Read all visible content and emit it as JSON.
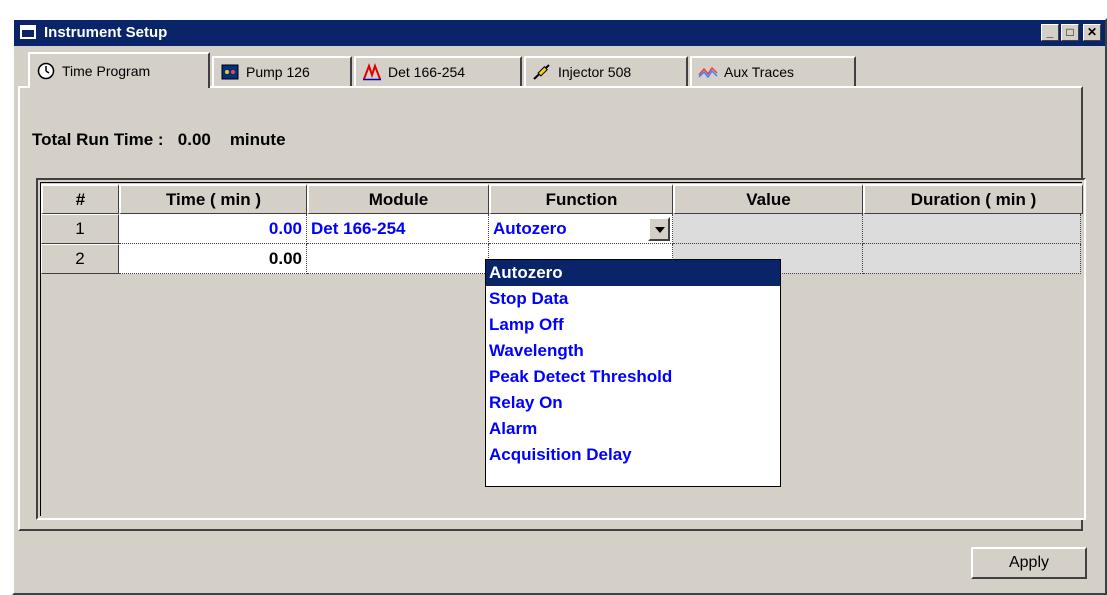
{
  "window": {
    "title": "Instrument Setup"
  },
  "tabs": [
    {
      "label": "Time Program",
      "icon": "clock-icon"
    },
    {
      "label": "Pump 126",
      "icon": "pump-icon"
    },
    {
      "label": "Det 166-254",
      "icon": "detector-peak-icon"
    },
    {
      "label": "Injector 508",
      "icon": "syringe-icon"
    },
    {
      "label": "Aux Traces",
      "icon": "traces-icon"
    }
  ],
  "total_run_time": {
    "label": "Total Run Time :",
    "value": "0.00",
    "unit": "minute"
  },
  "table": {
    "headers": [
      "#",
      "Time ( min )",
      "Module",
      "Function",
      "Value",
      "Duration ( min )"
    ],
    "rows": [
      {
        "num": "1",
        "time": "0.00",
        "module": "Det 166-254",
        "function": "Autozero",
        "value": "",
        "duration": ""
      },
      {
        "num": "2",
        "time": "0.00",
        "module": "",
        "function": "",
        "value": "",
        "duration": ""
      }
    ]
  },
  "dropdown": {
    "options": [
      "Autozero",
      "Stop Data",
      "Lamp Off",
      "Wavelength",
      "Peak Detect Threshold",
      "Relay On",
      "Alarm",
      "Acquisition Delay"
    ],
    "selected": "Autozero"
  },
  "buttons": {
    "apply": "Apply"
  },
  "colors": {
    "titlebar": "#0a246a",
    "face": "#d4d0c8",
    "link_text": "#0000ff"
  }
}
